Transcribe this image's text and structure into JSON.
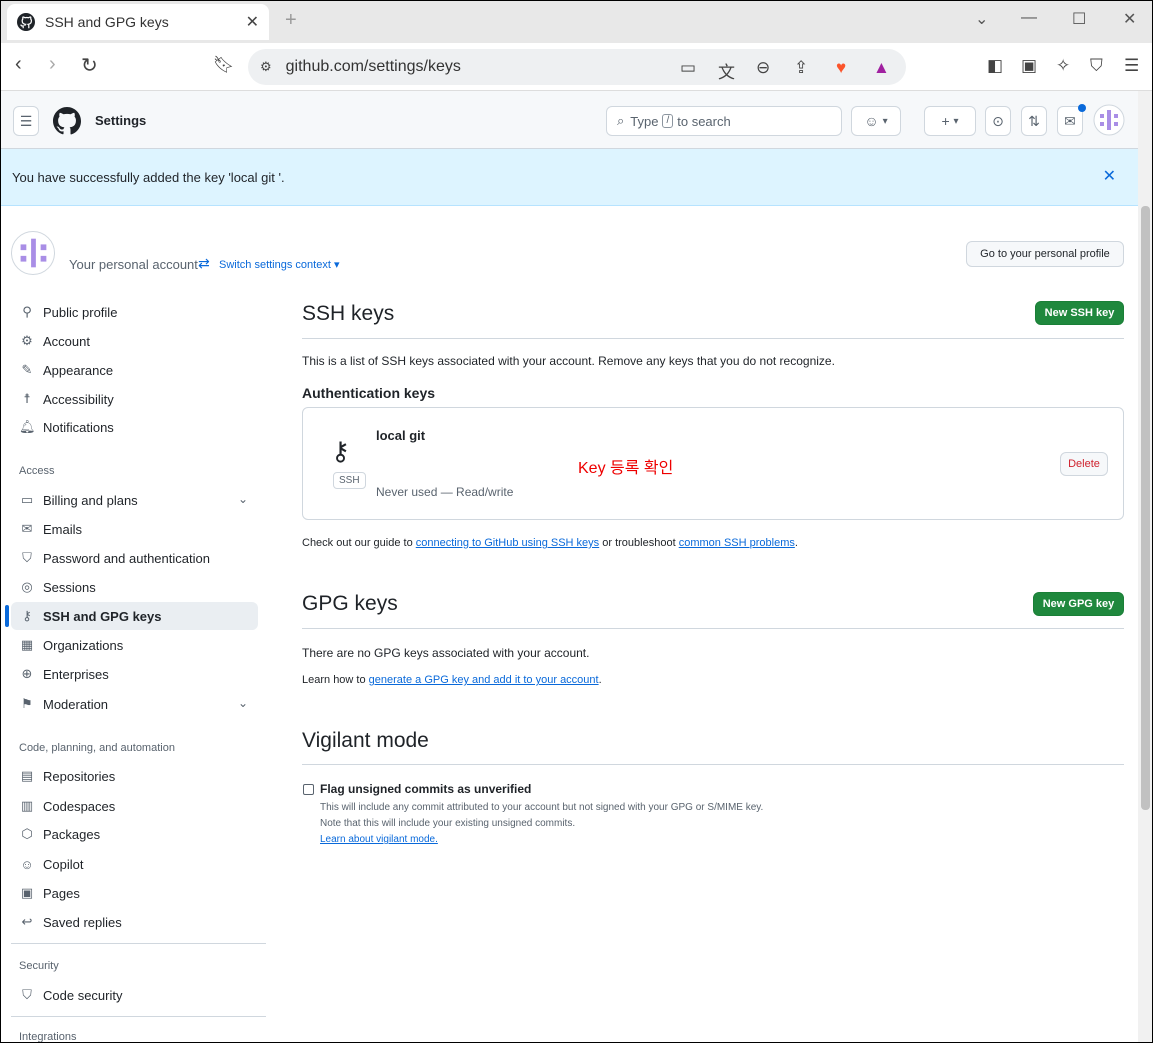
{
  "browser": {
    "tab_title": "SSH and GPG keys",
    "url": "github.com/settings/keys"
  },
  "header": {
    "title": "Settings",
    "search_text_before": "Type",
    "search_slash": "/",
    "search_text_after": "to search"
  },
  "flash": {
    "message": "You have successfully added the key 'local git '."
  },
  "context": {
    "account_label": "Your personal account",
    "switch_label": "Switch settings context ▾",
    "profile_button": "Go to your personal profile"
  },
  "sidebar": {
    "items_top": [
      {
        "label": "Public profile",
        "icon": "person-icon"
      },
      {
        "label": "Account",
        "icon": "gear-icon"
      },
      {
        "label": "Appearance",
        "icon": "paintbrush-icon"
      },
      {
        "label": "Accessibility",
        "icon": "accessibility-icon"
      },
      {
        "label": "Notifications",
        "icon": "bell-icon"
      }
    ],
    "access_heading": "Access",
    "items_access": [
      {
        "label": "Billing and plans",
        "icon": "credit-card-icon"
      },
      {
        "label": "Emails",
        "icon": "mail-icon"
      },
      {
        "label": "Password and authentication",
        "icon": "shield-lock-icon"
      },
      {
        "label": "Sessions",
        "icon": "broadcast-icon"
      },
      {
        "label": "SSH and GPG keys",
        "icon": "key-icon"
      },
      {
        "label": "Organizations",
        "icon": "organization-icon"
      },
      {
        "label": "Enterprises",
        "icon": "globe-icon"
      },
      {
        "label": "Moderation",
        "icon": "report-icon"
      }
    ],
    "code_heading": "Code, planning, and automation",
    "items_code": [
      {
        "label": "Repositories",
        "icon": "repo-icon"
      },
      {
        "label": "Codespaces",
        "icon": "codespaces-icon"
      },
      {
        "label": "Packages",
        "icon": "package-icon"
      },
      {
        "label": "Copilot",
        "icon": "copilot-icon"
      },
      {
        "label": "Pages",
        "icon": "browser-icon"
      },
      {
        "label": "Saved replies",
        "icon": "reply-icon"
      }
    ],
    "security_heading": "Security",
    "items_security": [
      {
        "label": "Code security",
        "icon": "shield-icon"
      }
    ],
    "integrations_heading": "Integrations"
  },
  "ssh": {
    "heading": "SSH keys",
    "new_button": "New SSH key",
    "description": "This is a list of SSH keys associated with your account. Remove any keys that you do not recognize.",
    "auth_heading": "Authentication keys",
    "key": {
      "title": "local git",
      "badge": "SSH",
      "meta": "Never used — Read/write",
      "delete_label": "Delete"
    },
    "annotation": "Key 등록 확인",
    "guide_prefix": "Check out our guide to",
    "guide_link1": "connecting to GitHub using SSH keys",
    "guide_middle": "or troubleshoot",
    "guide_link2": "common SSH problems",
    "guide_suffix": "."
  },
  "gpg": {
    "heading": "GPG keys",
    "new_button": "New GPG key",
    "empty": "There are no GPG keys associated with your account.",
    "learn_prefix": "Learn how to",
    "learn_link": "generate a GPG key and add it to your account",
    "learn_suffix": "."
  },
  "vigilant": {
    "heading": "Vigilant mode",
    "checkbox_label": "Flag unsigned commits as unverified",
    "help1": "This will include any commit attributed to your account but not signed with your GPG or S/MIME key.",
    "help2": "Note that this will include your existing unsigned commits.",
    "learn_link": "Learn about vigilant mode."
  }
}
